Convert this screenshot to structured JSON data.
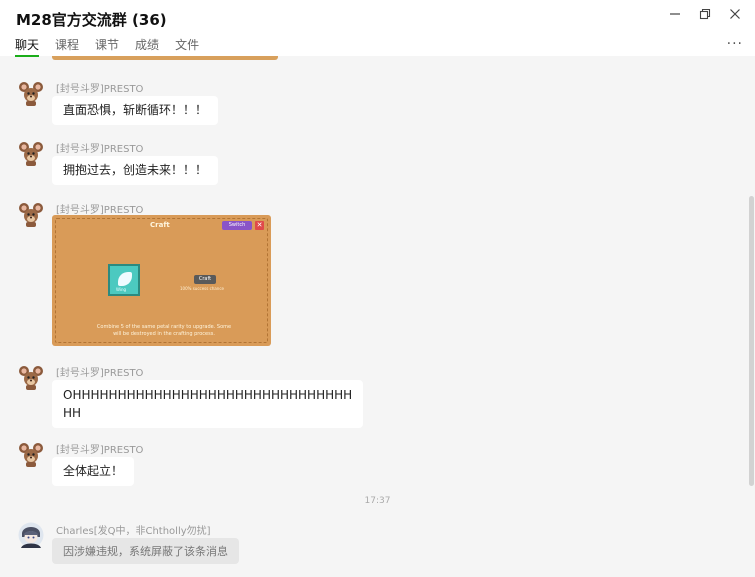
{
  "window": {
    "title": "M28官方交流群 (36)",
    "controls": [
      "minimize-icon",
      "restore-icon",
      "close-icon"
    ]
  },
  "tabs": [
    {
      "label": "聊天",
      "active": true
    },
    {
      "label": "课程",
      "active": false
    },
    {
      "label": "课节",
      "active": false
    },
    {
      "label": "成绩",
      "active": false
    },
    {
      "label": "文件",
      "active": false
    }
  ],
  "more_label": "···",
  "messages": [
    {
      "sender": "[封号斗罗]PRESTO",
      "text": "直面恐惧，斩断循环！！！"
    },
    {
      "sender": "[封号斗罗]PRESTO",
      "text": "拥抱过去，创造未来！！！"
    },
    {
      "sender": "[封号斗罗]PRESTO",
      "image": {
        "title": "Craft",
        "switch_label": "Switch",
        "close_label": "✕",
        "item_label": "Wing",
        "craft_label": "Craft",
        "craft_sub": "100% success chance",
        "footer": "Combine 5 of the same petal rarity to upgrade. Some will be destroyed in the crafting process."
      }
    },
    {
      "sender": "[封号斗罗]PRESTO",
      "text_line1": "OHHHHHHHHHHHHHHHHHHHHHHHHHHHHHHH",
      "text_line2": "HH"
    },
    {
      "sender": "[封号斗罗]PRESTO",
      "text": "全体起立！"
    }
  ],
  "timestamp": "17:37",
  "last_message": {
    "sender": "Charles[发Q中，非Chtholly勿扰]",
    "blocked_notice": "因涉嫌违规，系统屏蔽了该条消息"
  },
  "colors": {
    "accent": "#1aad19",
    "background": "#f5f5f5",
    "bubble": "#ffffff"
  }
}
